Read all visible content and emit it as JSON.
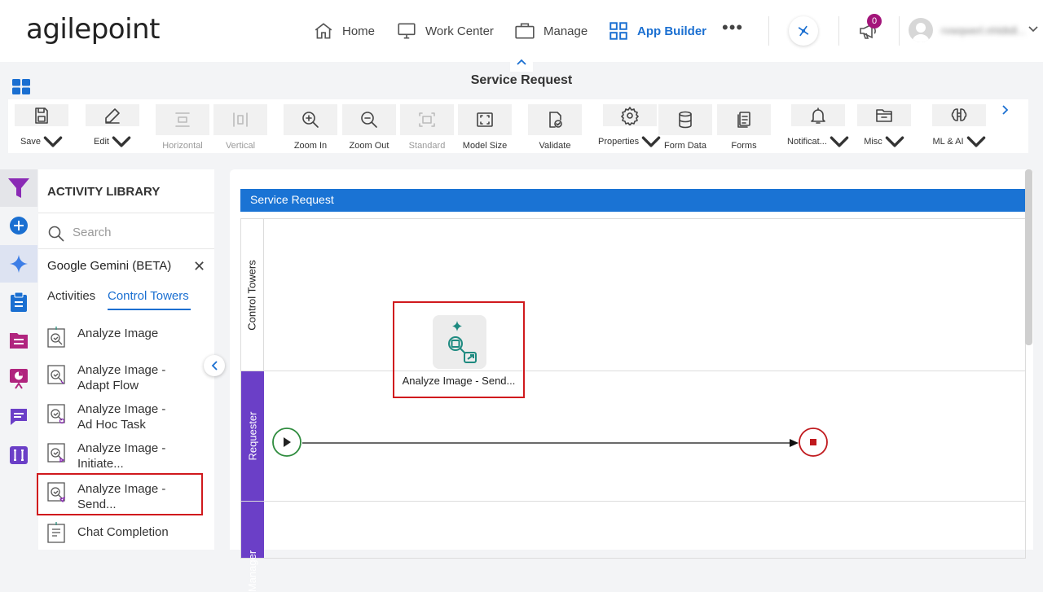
{
  "header": {
    "logo": "agilepoint",
    "nav": [
      {
        "label": "Home",
        "icon": "home-icon"
      },
      {
        "label": "Work Center",
        "icon": "monitor-icon"
      },
      {
        "label": "Manage",
        "icon": "briefcase-icon"
      },
      {
        "label": "App Builder",
        "icon": "grid-icon",
        "active": true
      }
    ],
    "notification_count": "0",
    "username": "rvwqwerl.nhldtdl..."
  },
  "app": {
    "title": "Service Request"
  },
  "toolbar": {
    "items": [
      {
        "label": "Save",
        "dropdown": true,
        "icon": "save-icon"
      },
      {
        "label": "Edit",
        "dropdown": true,
        "icon": "pencil-icon"
      },
      {
        "label": "Horizontal",
        "disabled": true,
        "icon": "horizontal-layout-icon"
      },
      {
        "label": "Vertical",
        "disabled": true,
        "icon": "vertical-layout-icon"
      },
      {
        "label": "Zoom In",
        "icon": "zoom-in-icon"
      },
      {
        "label": "Zoom Out",
        "icon": "zoom-out-icon"
      },
      {
        "label": "Standard",
        "disabled": true,
        "icon": "standard-size-icon"
      },
      {
        "label": "Model Size",
        "icon": "model-size-icon"
      },
      {
        "label": "Validate",
        "icon": "validate-icon"
      },
      {
        "label": "Properties",
        "dropdown": true,
        "icon": "gear-icon"
      },
      {
        "label": "Form Data",
        "icon": "database-icon"
      },
      {
        "label": "Forms",
        "icon": "forms-icon"
      },
      {
        "label": "Notificat...",
        "dropdown": true,
        "icon": "bell-icon"
      },
      {
        "label": "Misc",
        "dropdown": true,
        "icon": "folder-icon"
      },
      {
        "label": "ML & AI",
        "dropdown": true,
        "icon": "ai-brain-icon"
      }
    ]
  },
  "library": {
    "title": "ACTIVITY LIBRARY",
    "search_placeholder": "Search",
    "category": "Google Gemini (BETA)",
    "tabs": [
      "Activities",
      "Control Towers"
    ],
    "activities": [
      {
        "line1": "Analyze Image",
        "line2": ""
      },
      {
        "line1": "Analyze Image -",
        "line2": "Adapt Flow"
      },
      {
        "line1": "Analyze Image -",
        "line2": "Ad Hoc Task"
      },
      {
        "line1": "Analyze Image -",
        "line2": "Initiate..."
      },
      {
        "line1": "Analyze Image -",
        "line2": "Send...",
        "selected": true
      },
      {
        "line1": "Chat Completion",
        "line2": ""
      }
    ]
  },
  "canvas": {
    "pool_title": "Service Request",
    "lanes": [
      "Control Towers",
      "Requester",
      "Manager"
    ],
    "node_label": "Analyze Image - Send..."
  },
  "colors": {
    "accent": "#1a6fd1",
    "selection": "#d0191d",
    "requester_lane": "#6b3fc7",
    "badge": "#a3157a"
  }
}
